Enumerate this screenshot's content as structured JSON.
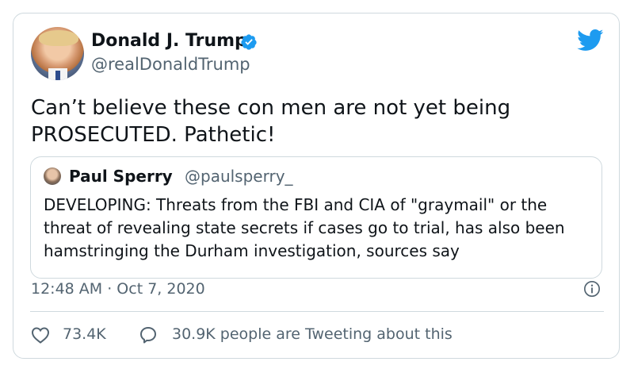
{
  "colors": {
    "brand": "#1d9bf0",
    "text_primary": "#0f1419",
    "text_secondary": "#536471",
    "border": "#cfd9de"
  },
  "author": {
    "name": "Donald J. Trump",
    "handle": "@realDonaldTrump",
    "verified_icon": "verified-badge-icon"
  },
  "tweet": {
    "line1": "Can’t believe these con men are not yet being",
    "line2": "PROSECUTED. Pathetic!"
  },
  "quoted": {
    "name": "Paul Sperry",
    "handle": "@paulsperry_",
    "line1": "DEVELOPING: Threats from the FBI and CIA of \"graymail\" or the",
    "line2": "threat of revealing state secrets if cases go to trial, has also been",
    "line3": "hamstringing the Durham investigation, sources say"
  },
  "meta": {
    "timestamp": "12:48 AM · Oct 7, 2020"
  },
  "actions": {
    "like_count": "73.4K",
    "tweeting_text": "30.9K people are Tweeting about this",
    "like_icon": "heart-icon",
    "reply_icon": "speech-bubble-icon",
    "info_icon": "info-icon",
    "brand_icon": "twitter-bird-icon"
  }
}
